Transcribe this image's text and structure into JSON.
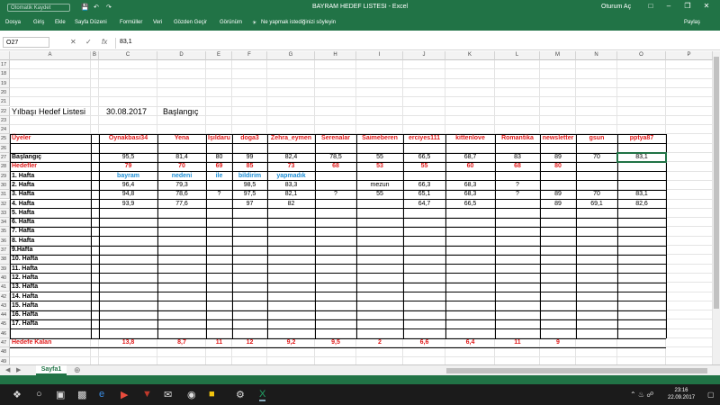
{
  "titlebar": {
    "autosave_label": "Otomatik Kaydet",
    "document_title": "BAYRAM HEDEF LISTESI  -  Excel",
    "signin": "Oturum Aç"
  },
  "ribbon": {
    "tabs": [
      "Dosya",
      "Giriş",
      "Ekle",
      "Sayfa Düzeni",
      "Formüller",
      "Veri",
      "Gözden Geçir",
      "Görünüm"
    ],
    "tellme": "Ne yapmak istediğinizi söyleyin",
    "share": "Paylaş"
  },
  "formula_bar": {
    "name_box": "O27",
    "formula": "83,1"
  },
  "columns": [
    "A",
    "B",
    "C",
    "D",
    "E",
    "F",
    "G",
    "H",
    "I",
    "J",
    "K",
    "L",
    "M",
    "N",
    "O",
    "P"
  ],
  "rows": [
    "17",
    "18",
    "19",
    "20",
    "21",
    "22",
    "23",
    "24",
    "25",
    "26",
    "27",
    "28",
    "29",
    "30",
    "31",
    "32",
    "33",
    "34",
    "35",
    "36",
    "37",
    "38",
    "39",
    "40",
    "41",
    "42",
    "43",
    "44",
    "45",
    "46",
    "47",
    "48",
    "49",
    "50"
  ],
  "sheet": {
    "title_a": "Yılbaşı Hedef Listesi",
    "date": "30.08.2017",
    "start_label": "Başlangıç",
    "users_label": "Üyeler",
    "users": [
      "Oynakbasi34",
      "Yena",
      "Işıldaru",
      "doga3",
      "Zehra_eymen",
      "Serenalar",
      "Saimeberen",
      "erciyes111",
      "kittenlove",
      "Romantika",
      "newsletter",
      "gsun",
      "pptya87"
    ],
    "baslangic": [
      "95,5",
      "81,4",
      "80",
      "99",
      "82,4",
      "78,5",
      "55",
      "66,5",
      "68,7",
      "83",
      "89",
      "70",
      "83,1"
    ],
    "hedefler_label": "Hedefler",
    "hedefler": [
      "79",
      "70",
      "69",
      "85",
      "73",
      "68",
      "53",
      "55",
      "60",
      "68",
      "80",
      "",
      ""
    ],
    "weeks": [
      "1. Hafta",
      "2. Hafta",
      "3. Hafta",
      "4. Hafta",
      "5. Hafta",
      "6. Hafta",
      "7. Hafta",
      "8. Hafta",
      "9.Hafta",
      "10. Hafta",
      "11. Hafta",
      "12. Hafta",
      "13. Hafta",
      "14. Hafta",
      "15. Hafta",
      "16. Hafta",
      "17. Hafta"
    ],
    "hafta1": [
      "bayram",
      "nedeni",
      "ile",
      "bildirim",
      "yapmadık",
      "",
      "",
      "",
      "",
      "",
      "",
      "",
      ""
    ],
    "hafta2": [
      "96,4",
      "79,3",
      "",
      "98,5",
      "83,3",
      "",
      "mezun",
      "66,3",
      "68,3",
      "?",
      "",
      "",
      ""
    ],
    "hafta3": [
      "94,8",
      "78,6",
      "?",
      "97,5",
      "82,1",
      "?",
      "55",
      "65,1",
      "68,3",
      "?",
      "89",
      "70",
      "83,1"
    ],
    "hafta4": [
      "93,9",
      "77,6",
      "",
      "97",
      "82",
      "",
      "",
      "64,7",
      "66,5",
      "",
      "89",
      "69,1",
      "82,6"
    ],
    "kalan_label": "Hedefe Kalan",
    "kalan": [
      "13,8",
      "8,7",
      "11",
      "12",
      "9,2",
      "9,5",
      "2",
      "6,6",
      "6,4",
      "11",
      "9",
      "",
      ""
    ]
  },
  "sheet_tab": "Sayfa1",
  "taskbar": {
    "time": "23:16",
    "date": "22.09.2017"
  },
  "colors": {
    "excel_green": "#217346",
    "red": "#e01b1b",
    "blue": "#1f8fd6"
  }
}
